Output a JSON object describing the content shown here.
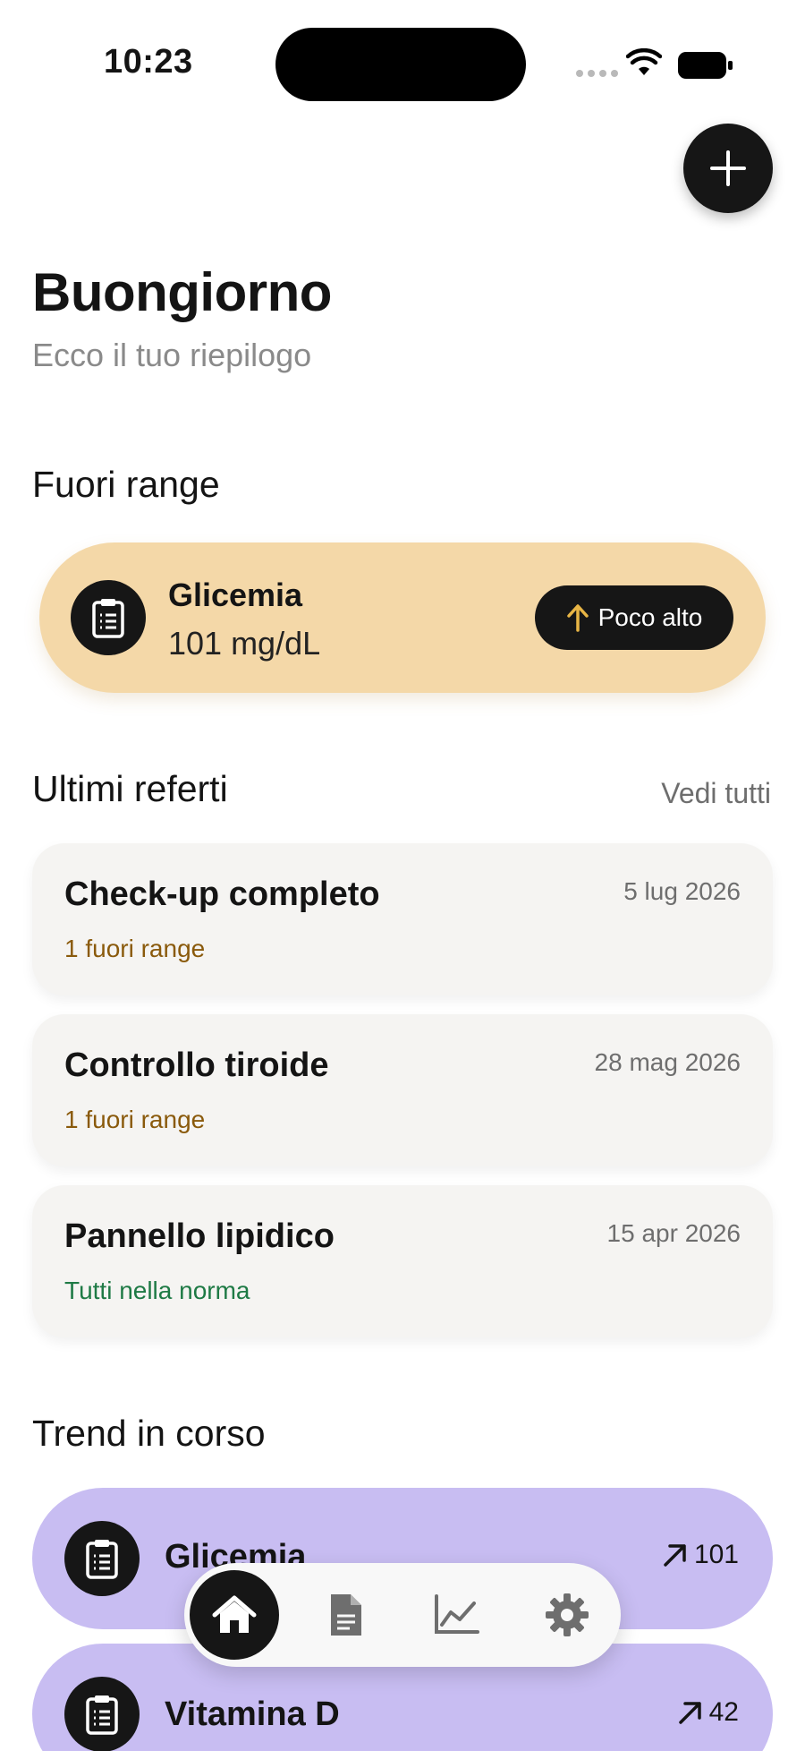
{
  "status_bar": {
    "time": "10:23"
  },
  "header": {
    "add_button_icon": "plus-icon"
  },
  "greeting": {
    "title": "Buongiorno",
    "subtitle": "Ecco il tuo riepilogo"
  },
  "out_of_range": {
    "section_title": "Fuori range",
    "items": [
      {
        "name": "Glicemia",
        "value": "101 mg/dL",
        "badge": "Poco alto",
        "badge_icon": "arrow-up-icon",
        "icon": "clipboard-icon"
      }
    ]
  },
  "reports": {
    "section_title": "Ultimi referti",
    "see_all": "Vedi tutti",
    "items": [
      {
        "title": "Check-up completo",
        "date": "5 lug 2026",
        "status": "1 fuori range",
        "status_type": "warning"
      },
      {
        "title": "Controllo tiroide",
        "date": "28 mag 2026",
        "status": "1 fuori range",
        "status_type": "warning"
      },
      {
        "title": "Pannello lipidico",
        "date": "15 apr 2026",
        "status": "Tutti nella norma",
        "status_type": "ok"
      }
    ]
  },
  "trends": {
    "section_title": "Trend in corso",
    "items": [
      {
        "name": "Glicemia",
        "value": "101",
        "trend_icon": "arrow-up-right-icon"
      },
      {
        "name": "Vitamina D",
        "value": "42",
        "trend_icon": "arrow-up-right-icon"
      }
    ]
  },
  "nav": {
    "items": [
      {
        "icon": "home-icon",
        "active": true
      },
      {
        "icon": "document-icon",
        "active": false
      },
      {
        "icon": "chart-icon",
        "active": false
      },
      {
        "icon": "gear-icon",
        "active": false
      }
    ]
  },
  "colors": {
    "warning_card": "#f4d8a8",
    "trend_card": "#c8bdf2",
    "warning_text": "#8a5a0c",
    "ok_text": "#1e7a45",
    "dark": "#161616"
  }
}
